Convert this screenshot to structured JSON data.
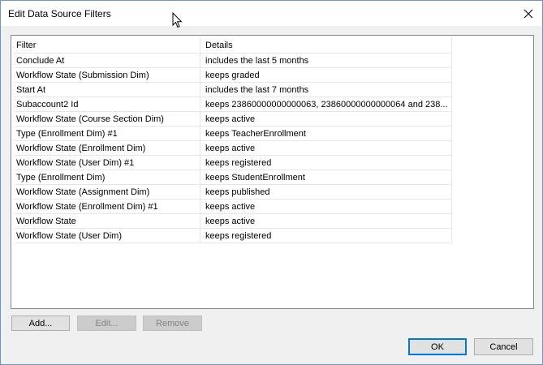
{
  "window": {
    "title": "Edit Data Source Filters"
  },
  "table": {
    "headers": [
      "Filter",
      "Details"
    ],
    "rows": [
      [
        "Conclude At",
        "includes the last 5 months"
      ],
      [
        "Workflow State (Submission Dim)",
        "keeps graded"
      ],
      [
        "Start At",
        "includes the last 7 months"
      ],
      [
        "Subaccount2 Id",
        "keeps 23860000000000063, 23860000000000064 and 238..."
      ],
      [
        "Workflow State (Course Section Dim)",
        "keeps active"
      ],
      [
        "Type (Enrollment Dim) #1",
        "keeps TeacherEnrollment"
      ],
      [
        "Workflow State (Enrollment Dim)",
        "keeps active"
      ],
      [
        "Workflow State (User Dim) #1",
        "keeps registered"
      ],
      [
        "Type (Enrollment Dim)",
        "keeps StudentEnrollment"
      ],
      [
        "Workflow State (Assignment Dim)",
        "keeps published"
      ],
      [
        "Workflow State (Enrollment Dim) #1",
        "keeps active"
      ],
      [
        "Workflow State",
        "keeps active"
      ],
      [
        "Workflow State (User Dim)",
        "keeps registered"
      ]
    ]
  },
  "buttons": {
    "add": "Add...",
    "edit": "Edit...",
    "remove": "Remove",
    "ok": "OK",
    "cancel": "Cancel"
  },
  "icons": {
    "close": "close-icon",
    "cursor": "mouse-cursor-icon"
  }
}
